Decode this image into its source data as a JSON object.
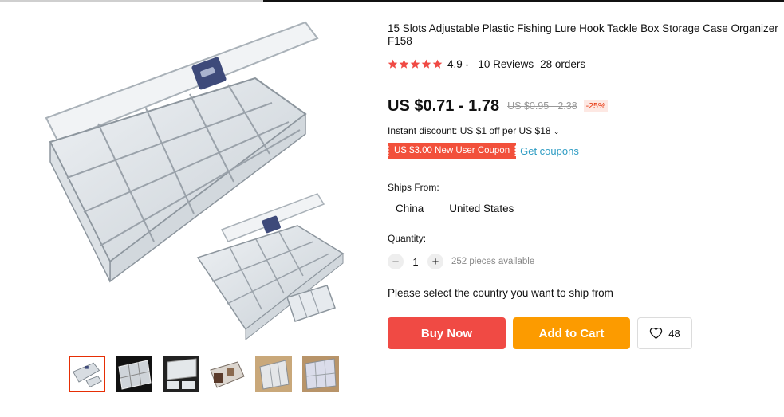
{
  "product": {
    "title": "15 Slots Adjustable Plastic Fishing Lure Hook Tackle Box Storage Case Organizer F158",
    "rating": {
      "value": "4.9",
      "stars": 5,
      "reviews": "10 Reviews",
      "orders": "28 orders",
      "star_color": "#f04a44"
    },
    "price": {
      "current": "US $0.71 - 1.78",
      "original": "US $0.95 - 2.38",
      "discount": "-25%"
    },
    "instant_discount": "Instant discount: US $1 off per US $18",
    "coupon": {
      "badge": "US $3.00 New User Coupon",
      "link": "Get coupons"
    },
    "ships_from": {
      "label": "Ships From:",
      "options": [
        "China",
        "United States"
      ]
    },
    "quantity": {
      "label": "Quantity:",
      "minus": "−",
      "value": "1",
      "plus": "+",
      "available": "252 pieces available"
    },
    "ship_message": "Please select the country you want to ship from",
    "actions": {
      "buy_now": "Buy Now",
      "add_to_cart": "Add to Cart",
      "wishlist_count": "48"
    }
  },
  "gallery": {
    "thumbnails": [
      {
        "icon": "tackle-box-thumb-1",
        "active": true
      },
      {
        "icon": "tackle-box-thumb-2",
        "active": false
      },
      {
        "icon": "tackle-box-thumb-3",
        "active": false
      },
      {
        "icon": "tackle-box-thumb-4",
        "active": false
      },
      {
        "icon": "tackle-box-thumb-5",
        "active": false
      },
      {
        "icon": "tackle-box-thumb-6",
        "active": false
      }
    ]
  },
  "colors": {
    "accent_red": "#f04a44",
    "accent_orange": "#fc9b00",
    "link_blue": "#2e9cc3",
    "thumb_active_border": "#e62e04"
  }
}
